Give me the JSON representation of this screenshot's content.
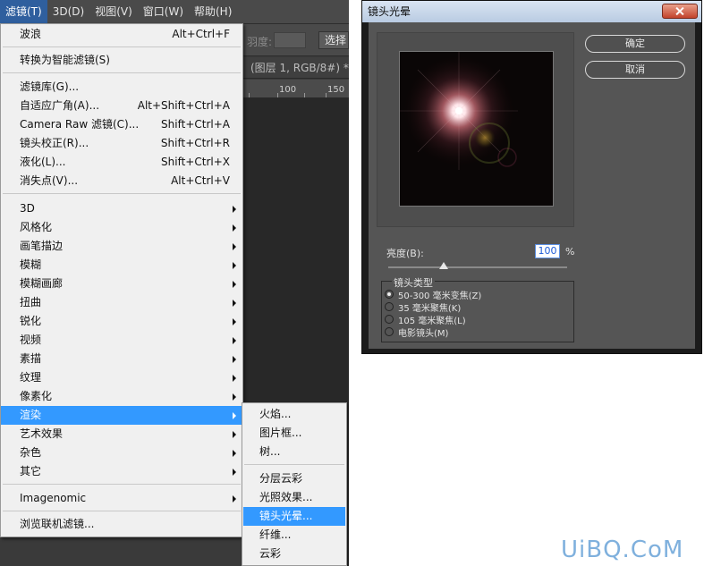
{
  "menubar": {
    "items": [
      "滤镜(T)",
      "3D(D)",
      "视图(V)",
      "窗口(W)",
      "帮助(H)"
    ],
    "active_index": 0
  },
  "options_bar": {
    "hint": "羽度:",
    "select_label": "选择"
  },
  "document_tab": {
    "title": "(图层 1, RGB/8#) *"
  },
  "ruler": {
    "labels": [
      "100",
      "150"
    ]
  },
  "filter_menu": {
    "items": [
      {
        "label": "波浪",
        "shortcut": "Alt+Ctrl+F"
      },
      {
        "label": "转换为智能滤镜(S)",
        "shortcut": ""
      },
      {
        "label": "滤镜库(G)...",
        "shortcut": ""
      },
      {
        "label": "自适应广角(A)...",
        "shortcut": "Alt+Shift+Ctrl+A"
      },
      {
        "label": "Camera Raw 滤镜(C)...",
        "shortcut": "Shift+Ctrl+A"
      },
      {
        "label": "镜头校正(R)...",
        "shortcut": "Shift+Ctrl+R"
      },
      {
        "label": "液化(L)...",
        "shortcut": "Shift+Ctrl+X"
      },
      {
        "label": "消失点(V)...",
        "shortcut": "Alt+Ctrl+V"
      },
      {
        "label": "3D",
        "submenu": true
      },
      {
        "label": "风格化",
        "submenu": true
      },
      {
        "label": "画笔描边",
        "submenu": true
      },
      {
        "label": "模糊",
        "submenu": true
      },
      {
        "label": "模糊画廊",
        "submenu": true
      },
      {
        "label": "扭曲",
        "submenu": true
      },
      {
        "label": "锐化",
        "submenu": true
      },
      {
        "label": "视频",
        "submenu": true
      },
      {
        "label": "素描",
        "submenu": true
      },
      {
        "label": "纹理",
        "submenu": true
      },
      {
        "label": "像素化",
        "submenu": true
      },
      {
        "label": "渲染",
        "submenu": true,
        "highlighted": true
      },
      {
        "label": "艺术效果",
        "submenu": true
      },
      {
        "label": "杂色",
        "submenu": true
      },
      {
        "label": "其它",
        "submenu": true
      },
      {
        "label": "Imagenomic",
        "submenu": true
      },
      {
        "label": "浏览联机滤镜...",
        "shortcut": ""
      }
    ]
  },
  "render_submenu": {
    "items": [
      "火焰...",
      "图片框...",
      "树...",
      "分层云彩",
      "光照效果...",
      "镜头光晕...",
      "纤维...",
      "云彩"
    ],
    "highlighted_index": 5
  },
  "dialog": {
    "title": "镜头光晕",
    "ok_label": "确定",
    "cancel_label": "取消",
    "brightness_label": "亮度(B):",
    "brightness_value": "100",
    "brightness_unit": "%",
    "lens_group_label": "镜头类型",
    "lens_types": [
      "50-300 毫米变焦(Z)",
      "35 毫米聚焦(K)",
      "105 毫米聚焦(L)",
      "电影镜头(M)"
    ],
    "lens_selected_index": 0,
    "slider_fraction": 0.4
  },
  "watermark": "UiBQ.CoM",
  "colors": {
    "menu_highlight": "#3399ff",
    "dialog_body": "#555555",
    "ps_dark": "#3a3a3a"
  }
}
